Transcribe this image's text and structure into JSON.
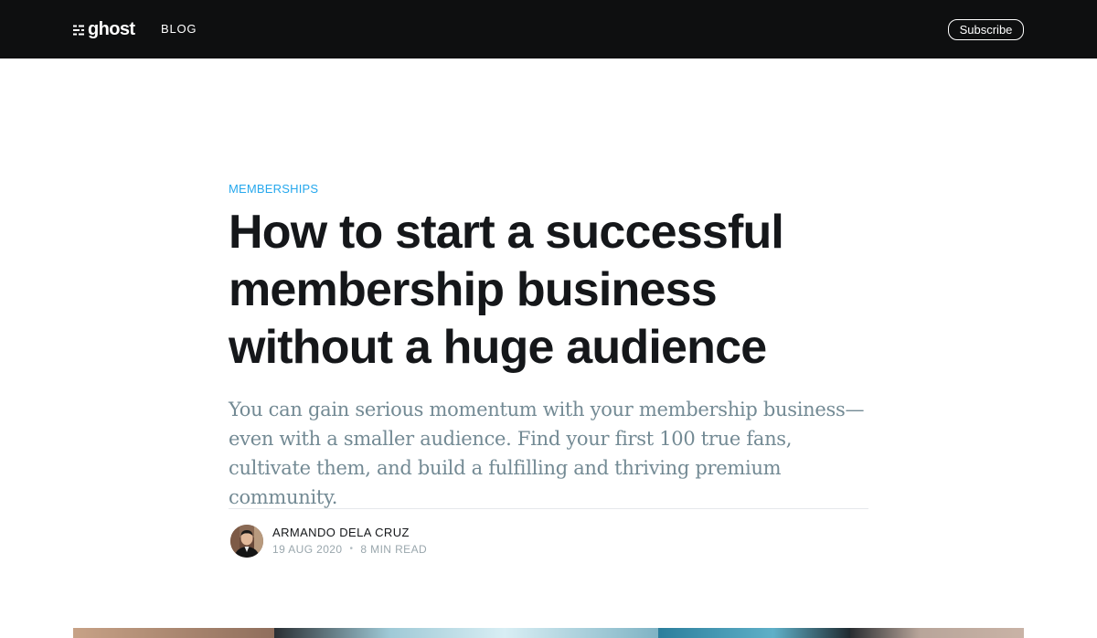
{
  "nav": {
    "logo_text": "ghost",
    "logo_icon": "ghost-logo-mark",
    "blog_label": "BLOG",
    "subscribe_label": "Subscribe"
  },
  "article": {
    "tag": "MEMBERSHIPS",
    "title": "How to start a successful membership business without a huge audience",
    "excerpt": "You can gain serious momentum with your membership business—even with a smaller audience. Find your first 100 true fans, cultivate them, and build a fulfilling and thriving premium community.",
    "author_name": "ARMANDO DELA CRUZ",
    "date": "19 AUG 2020",
    "separator": "•",
    "read_time": "8 MIN READ"
  },
  "colors": {
    "nav_background": "#0e0f10",
    "accent": "#26a8ed",
    "title": "#15171a",
    "excerpt": "#738a94",
    "meta": "#9aa7ad"
  }
}
